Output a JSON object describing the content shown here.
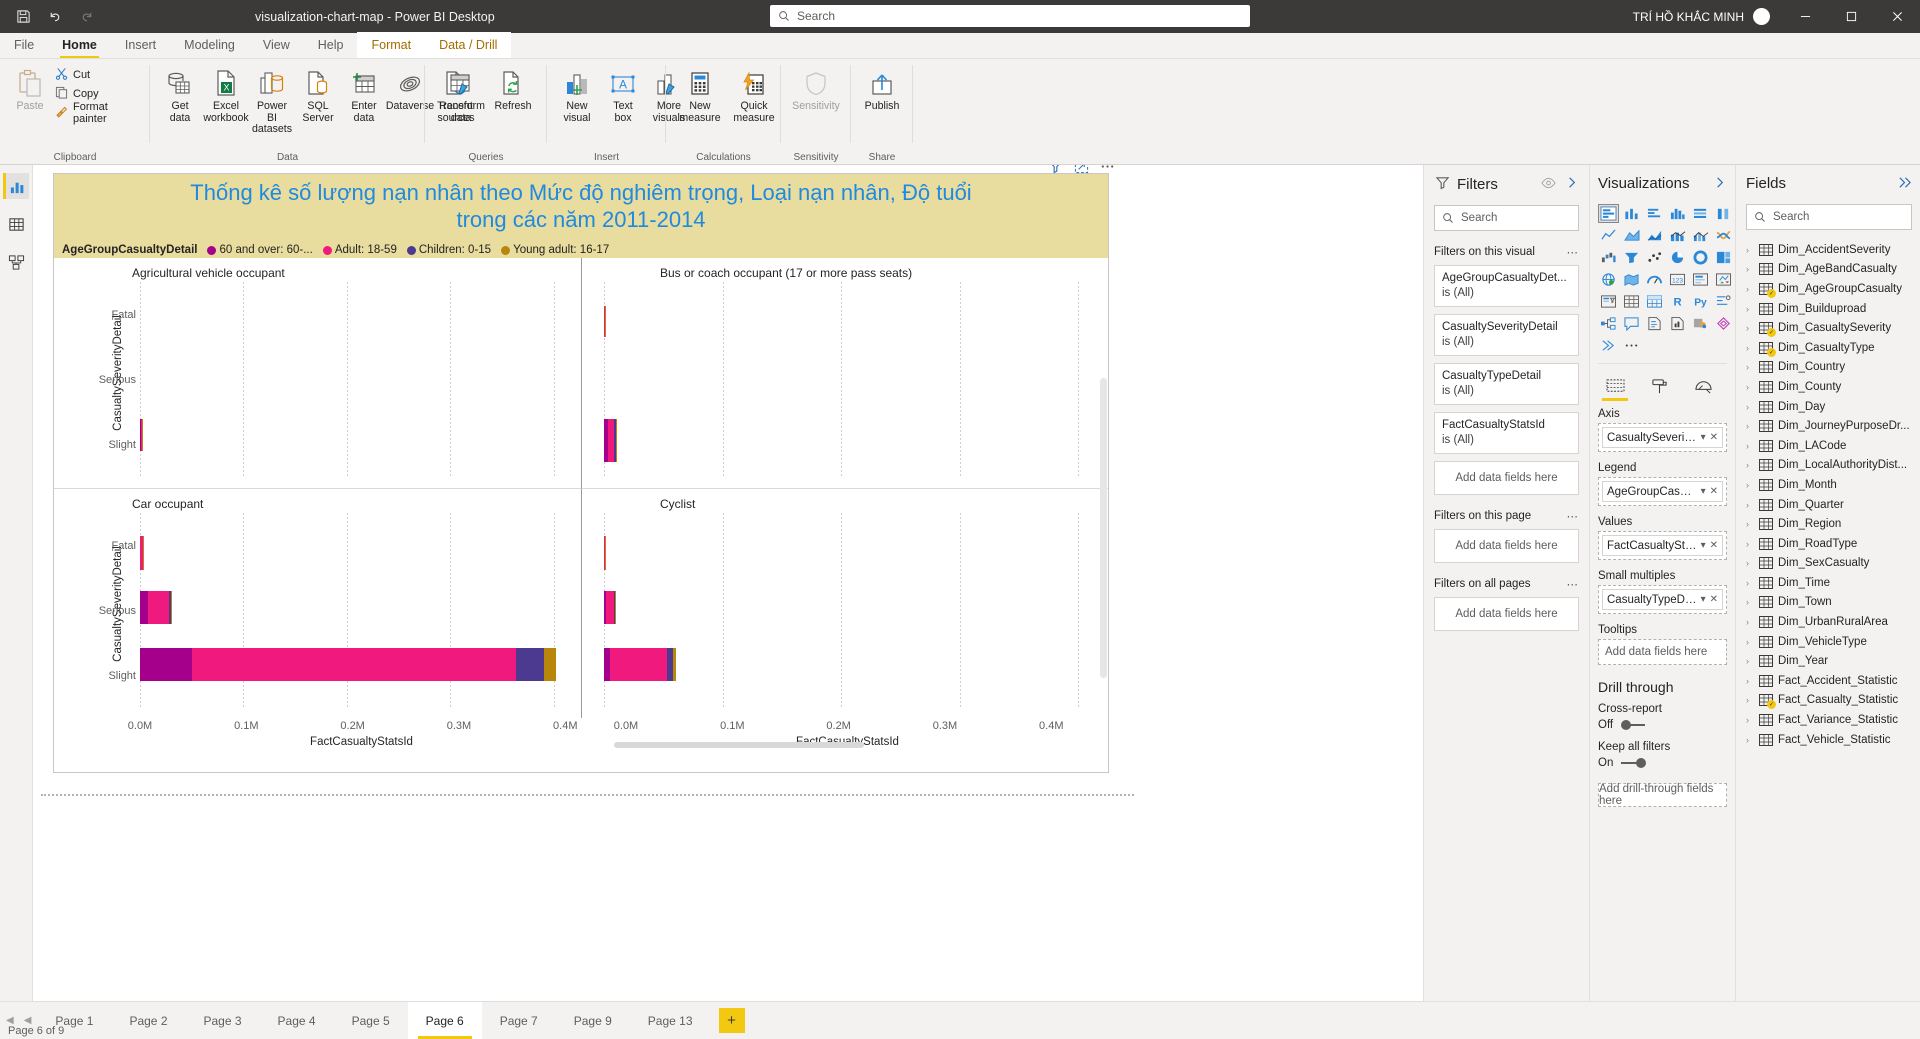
{
  "titlebar": {
    "title": "visualization-chart-map - Power BI Desktop",
    "search_placeholder": "Search",
    "user": "TRÍ HỒ KHẮC MINH",
    "icons": [
      "save-icon",
      "undo-icon",
      "redo-icon"
    ],
    "window_buttons": [
      "minimize",
      "restore",
      "close"
    ]
  },
  "menubar": {
    "items": [
      {
        "label": "File",
        "state": "normal"
      },
      {
        "label": "Home",
        "state": "active"
      },
      {
        "label": "Insert",
        "state": "normal"
      },
      {
        "label": "Modeling",
        "state": "normal"
      },
      {
        "label": "View",
        "state": "normal"
      },
      {
        "label": "Help",
        "state": "normal"
      },
      {
        "label": "Format",
        "state": "context"
      },
      {
        "label": "Data / Drill",
        "state": "context"
      }
    ]
  },
  "ribbon": {
    "groups": [
      {
        "name": "Clipboard",
        "big": [
          {
            "label": "Paste",
            "icon": "paste-icon",
            "disabled": true
          }
        ],
        "small": [
          {
            "label": "Cut",
            "icon": "cut-icon"
          },
          {
            "label": "Copy",
            "icon": "copy-icon"
          },
          {
            "label": "Format painter",
            "icon": "format-painter-icon"
          }
        ]
      },
      {
        "name": "Data",
        "big": [
          {
            "label": "Get\ndata",
            "icon": "get-data-icon",
            "caret": true
          },
          {
            "label": "Excel\nworkbook",
            "icon": "excel-icon"
          },
          {
            "label": "Power BI\ndatasets",
            "icon": "powerbi-datasets-icon"
          },
          {
            "label": "SQL\nServer",
            "icon": "sql-server-icon"
          },
          {
            "label": "Enter\ndata",
            "icon": "enter-data-icon"
          },
          {
            "label": "Dataverse",
            "icon": "dataverse-icon"
          },
          {
            "label": "Recent\nsources",
            "icon": "recent-sources-icon",
            "caret": true
          }
        ]
      },
      {
        "name": "Queries",
        "big": [
          {
            "label": "Transform\ndata",
            "icon": "transform-data-icon",
            "caret": true
          },
          {
            "label": "Refresh",
            "icon": "refresh-icon"
          }
        ]
      },
      {
        "name": "Insert",
        "big": [
          {
            "label": "New\nvisual",
            "icon": "new-visual-icon"
          },
          {
            "label": "Text\nbox",
            "icon": "text-box-icon"
          },
          {
            "label": "More\nvisuals",
            "icon": "more-visuals-icon",
            "caret": true
          }
        ]
      },
      {
        "name": "Calculations",
        "big": [
          {
            "label": "New\nmeasure",
            "icon": "new-measure-icon"
          },
          {
            "label": "Quick\nmeasure",
            "icon": "quick-measure-icon"
          }
        ]
      },
      {
        "name": "Sensitivity",
        "big": [
          {
            "label": "Sensitivity",
            "icon": "sensitivity-icon",
            "caret": true,
            "disabled": true
          }
        ]
      },
      {
        "name": "Share",
        "big": [
          {
            "label": "Publish",
            "icon": "publish-icon"
          }
        ]
      }
    ]
  },
  "leftbar": {
    "items": [
      {
        "name": "report-view-icon",
        "selected": true
      },
      {
        "name": "data-view-icon",
        "selected": false
      },
      {
        "name": "model-view-icon",
        "selected": false
      }
    ]
  },
  "visual": {
    "title_line1": "Thống kê số lượng nạn nhân theo Mức độ nghiêm trọng, Loại nạn nhân, Độ tuổi",
    "title_line2": "trong các năm 2011-2014",
    "header_bg": "#e8dc9e",
    "title_color": "#1f8ae0",
    "controls": [
      "filter-icon",
      "focus-mode-icon",
      "more-options-icon"
    ]
  },
  "chart_data": {
    "type": "bar",
    "orientation": "horizontal",
    "stacked": true,
    "small_multiples_field": "CasualtyTypeDetail",
    "legend_title": "AgeGroupCasualtyDetail",
    "legend": [
      {
        "label": "60 and over: 60-...",
        "color": "#a5008c"
      },
      {
        "label": "Adult: 18-59",
        "color": "#f0197e"
      },
      {
        "label": "Children: 0-15",
        "color": "#4b3a8f"
      },
      {
        "label": "Young adult: 16-17",
        "color": "#b8860b"
      }
    ],
    "categories": [
      "Fatal",
      "Serious",
      "Slight"
    ],
    "ylabel": "CasualtySeverityDetail",
    "xlabel": "FactCasualtyStatsId",
    "xticks": [
      "0.0M",
      "0.1M",
      "0.2M",
      "0.3M",
      "0.4M"
    ],
    "xlim": [
      0,
      0.45
    ],
    "grid": true,
    "panels": [
      {
        "title": "Agricultural vehicle occupant",
        "series": [
          {
            "category": "Fatal",
            "values": [
              0,
              0,
              0,
              0
            ]
          },
          {
            "category": "Serious",
            "values": [
              0,
              0,
              0,
              0
            ]
          },
          {
            "category": "Slight",
            "values": [
              0.0003,
              0.0005,
              0.0001,
              0.0001
            ]
          }
        ]
      },
      {
        "title": "Bus or coach occupant (17 or more pass seats)",
        "series": [
          {
            "category": "Fatal",
            "values": [
              0.0004,
              0.0005,
              0.0001,
              0.0001
            ]
          },
          {
            "category": "Serious",
            "values": [
              0,
              0,
              0,
              0
            ]
          },
          {
            "category": "Slight",
            "values": [
              0.004,
              0.006,
              0.001,
              0.0008
            ]
          }
        ]
      },
      {
        "title": "Car occupant",
        "series": [
          {
            "category": "Fatal",
            "values": [
              0.0005,
              0.0028,
              0.0004,
              0.0004
            ]
          },
          {
            "category": "Serious",
            "values": [
              0.0085,
              0.0215,
              0.0018,
              0.0012
            ]
          },
          {
            "category": "Slight",
            "values": [
              0.0498,
              0.3205,
              0.0262,
              0.0105
            ]
          }
        ]
      },
      {
        "title": "Cyclist",
        "series": [
          {
            "category": "Fatal",
            "values": [
              0.0002,
              0.0004,
              0.0001,
              0.0001
            ]
          },
          {
            "category": "Serious",
            "values": [
              0.0018,
              0.0075,
              0.0008,
              0.0004
            ]
          },
          {
            "category": "Slight",
            "values": [
              0.0052,
              0.0485,
              0.0052,
              0.0022
            ]
          }
        ]
      }
    ]
  },
  "filters_pane": {
    "title": "Filters",
    "search_placeholder": "Search",
    "sections": [
      {
        "label": "Filters on this visual",
        "cards": [
          {
            "field": "AgeGroupCasualtyDet...",
            "value": "is (All)"
          },
          {
            "field": "CasualtySeverityDetail",
            "value": "is (All)"
          },
          {
            "field": "CasualtyTypeDetail",
            "value": "is (All)"
          },
          {
            "field": "FactCasualtyStatsId",
            "value": "is (All)"
          }
        ],
        "dropzone": "Add data fields here"
      },
      {
        "label": "Filters on this page",
        "cards": [],
        "dropzone": "Add data fields here"
      },
      {
        "label": "Filters on all pages",
        "cards": [],
        "dropzone": "Add data fields here"
      }
    ]
  },
  "viz_pane": {
    "title": "Visualizations",
    "tabs": [
      "fields-tab",
      "format-tab",
      "analytics-tab"
    ],
    "wells": [
      {
        "label": "Axis",
        "chip": "CasualtySeverityDetail"
      },
      {
        "label": "Legend",
        "chip": "AgeGroupCasualtyDe..."
      },
      {
        "label": "Values",
        "chip": "FactCasualtyStatsId"
      },
      {
        "label": "Small multiples",
        "chip": "CasualtyTypeDetail"
      },
      {
        "label": "Tooltips",
        "chip": null,
        "placeholder": "Add data fields here"
      }
    ],
    "drill_through": {
      "title": "Drill through",
      "cross_report_label": "Cross-report",
      "cross_report_state": "Off",
      "keep_filters_label": "Keep all filters",
      "keep_filters_state": "On",
      "dropzone": "Add drill-through fields here"
    }
  },
  "fields_pane": {
    "title": "Fields",
    "search_placeholder": "Search",
    "tables": [
      {
        "name": "Dim_AccidentSeverity",
        "checked": false
      },
      {
        "name": "Dim_AgeBandCasualty",
        "checked": false
      },
      {
        "name": "Dim_AgeGroupCasualty",
        "checked": true
      },
      {
        "name": "Dim_Builduproad",
        "checked": false
      },
      {
        "name": "Dim_CasualtySeverity",
        "checked": true
      },
      {
        "name": "Dim_CasualtyType",
        "checked": true
      },
      {
        "name": "Dim_Country",
        "checked": false
      },
      {
        "name": "Dim_County",
        "checked": false
      },
      {
        "name": "Dim_Day",
        "checked": false
      },
      {
        "name": "Dim_JourneyPurposeDr...",
        "checked": false
      },
      {
        "name": "Dim_LACode",
        "checked": false
      },
      {
        "name": "Dim_LocalAuthorityDist...",
        "checked": false
      },
      {
        "name": "Dim_Month",
        "checked": false
      },
      {
        "name": "Dim_Quarter",
        "checked": false
      },
      {
        "name": "Dim_Region",
        "checked": false
      },
      {
        "name": "Dim_RoadType",
        "checked": false
      },
      {
        "name": "Dim_SexCasualty",
        "checked": false
      },
      {
        "name": "Dim_Time",
        "checked": false
      },
      {
        "name": "Dim_Town",
        "checked": false
      },
      {
        "name": "Dim_UrbanRuralArea",
        "checked": false
      },
      {
        "name": "Dim_VehicleType",
        "checked": false
      },
      {
        "name": "Dim_Year",
        "checked": false
      },
      {
        "name": "Fact_Accident_Statistic",
        "checked": false
      },
      {
        "name": "Fact_Casualty_Statistic",
        "checked": true
      },
      {
        "name": "Fact_Variance_Statistic",
        "checked": false
      },
      {
        "name": "Fact_Vehicle_Statistic",
        "checked": false
      }
    ]
  },
  "pagebar": {
    "tabs": [
      {
        "label": "Page 1",
        "active": false
      },
      {
        "label": "Page 2",
        "active": false
      },
      {
        "label": "Page 3",
        "active": false
      },
      {
        "label": "Page 4",
        "active": false
      },
      {
        "label": "Page 5",
        "active": false
      },
      {
        "label": "Page 6",
        "active": true
      },
      {
        "label": "Page 7",
        "active": false
      },
      {
        "label": "Page 9",
        "active": false
      },
      {
        "label": "Page 13",
        "active": false
      }
    ],
    "add_label": "+"
  },
  "statusbar": {
    "text": "Page 6 of 9"
  }
}
